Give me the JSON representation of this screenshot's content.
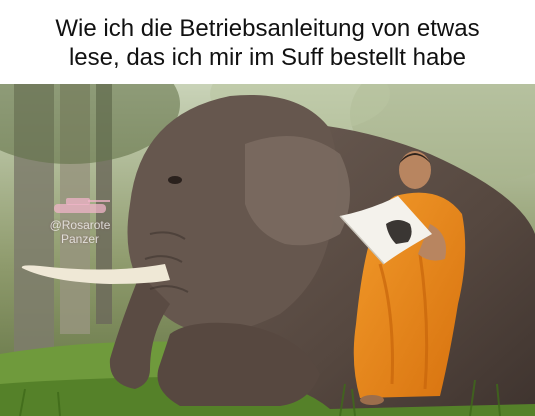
{
  "caption": {
    "line1": "Wie ich die Betriebsanleitung von etwas",
    "line2": "lese, das ich mir im Suff bestellt habe"
  },
  "watermark": {
    "line1": "@Rosarote",
    "line2": "Panzer",
    "icon": "tank-icon"
  },
  "photo": {
    "subject": "elephant-and-monk",
    "palette": {
      "sky": "#c9d3b8",
      "forest": "#7d8a5e",
      "grass": "#6f9a3c",
      "elephant": "#5e5049",
      "robe": "#e98a1f",
      "tusk": "#efe8d6"
    }
  }
}
